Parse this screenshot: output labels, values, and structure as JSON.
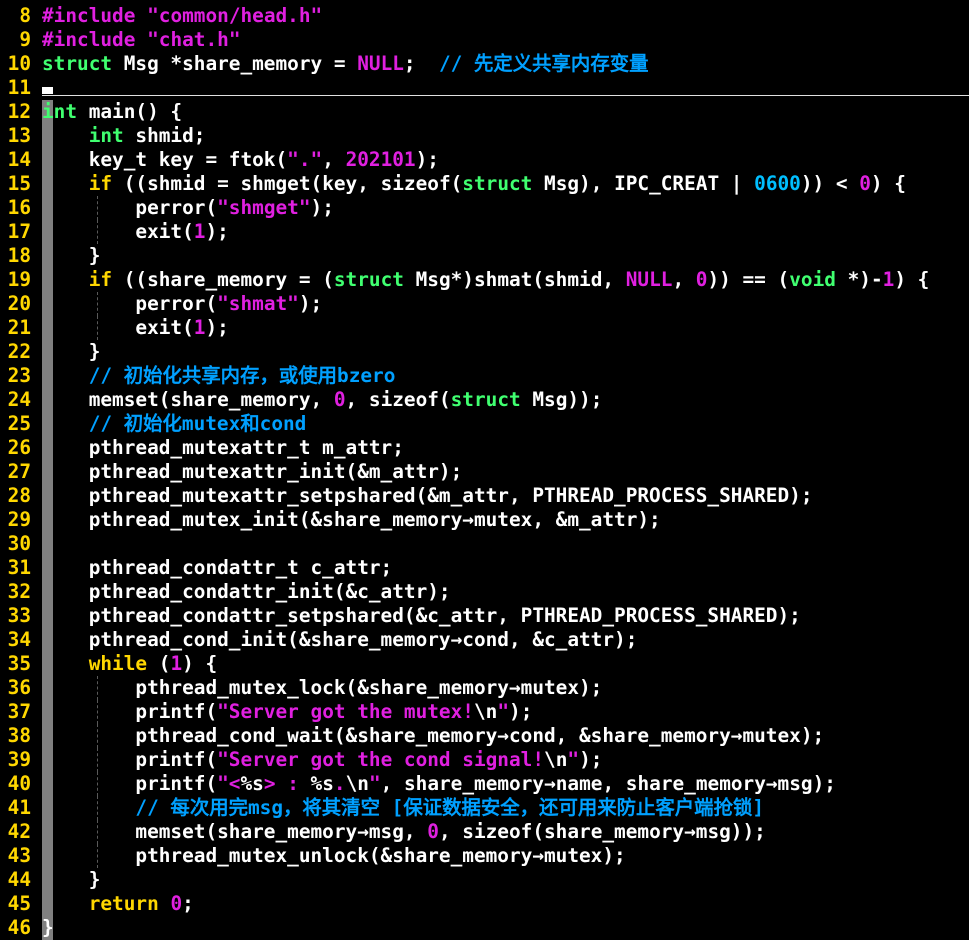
{
  "editor": {
    "colors": {
      "background": "#000000",
      "line_number": "#ffd700",
      "preprocessor": "#e020e0",
      "string": "#e020e0",
      "number": "#e020e0",
      "type": "#40ff70",
      "keyword": "#ffd700",
      "comment": "#00a0ff",
      "text": "#ffffff"
    },
    "lines": [
      {
        "n": "8",
        "tokens": [
          [
            "pp",
            "#include"
          ],
          [
            "txt",
            " "
          ],
          [
            "str",
            "\"common/head.h\""
          ]
        ]
      },
      {
        "n": "9",
        "tokens": [
          [
            "pp",
            "#include"
          ],
          [
            "txt",
            " "
          ],
          [
            "str",
            "\"chat.h\""
          ]
        ]
      },
      {
        "n": "10",
        "tokens": [
          [
            "type",
            "struct"
          ],
          [
            "txt",
            " Msg *share_memory = "
          ],
          [
            "num",
            "NULL"
          ],
          [
            "txt",
            ";  "
          ],
          [
            "cmt",
            "// 先定义共享内存变量"
          ]
        ]
      },
      {
        "n": "11",
        "tokens": []
      },
      {
        "n": "12",
        "tokens": [
          [
            "type",
            "int"
          ],
          [
            "txt",
            " main() {"
          ]
        ]
      },
      {
        "n": "13",
        "tokens": [
          [
            "txt",
            "    "
          ],
          [
            "type",
            "int"
          ],
          [
            "txt",
            " shmid;"
          ]
        ]
      },
      {
        "n": "14",
        "tokens": [
          [
            "txt",
            "    key_t key = ftok("
          ],
          [
            "str",
            "\".\""
          ],
          [
            "txt",
            ", "
          ],
          [
            "num",
            "202101"
          ],
          [
            "txt",
            ");"
          ]
        ]
      },
      {
        "n": "15",
        "tokens": [
          [
            "txt",
            "    "
          ],
          [
            "kw",
            "if"
          ],
          [
            "txt",
            " ((shmid = shmget(key, sizeof("
          ],
          [
            "type",
            "struct"
          ],
          [
            "txt",
            " Msg), IPC_CREAT | "
          ],
          [
            "hex",
            "0600"
          ],
          [
            "txt",
            ")) < "
          ],
          [
            "num",
            "0"
          ],
          [
            "txt",
            ") {"
          ]
        ]
      },
      {
        "n": "16",
        "tokens": [
          [
            "txt",
            "        perror("
          ],
          [
            "str",
            "\"shmget\""
          ],
          [
            "txt",
            ");"
          ]
        ]
      },
      {
        "n": "17",
        "tokens": [
          [
            "txt",
            "        exit("
          ],
          [
            "num",
            "1"
          ],
          [
            "txt",
            ");"
          ]
        ]
      },
      {
        "n": "18",
        "tokens": [
          [
            "txt",
            "    }"
          ]
        ]
      },
      {
        "n": "19",
        "tokens": [
          [
            "txt",
            "    "
          ],
          [
            "kw",
            "if"
          ],
          [
            "txt",
            " ((share_memory = ("
          ],
          [
            "type",
            "struct"
          ],
          [
            "txt",
            " Msg*)shmat(shmid, "
          ],
          [
            "num",
            "NULL"
          ],
          [
            "txt",
            ", "
          ],
          [
            "num",
            "0"
          ],
          [
            "txt",
            ")) == ("
          ],
          [
            "type",
            "void"
          ],
          [
            "txt",
            " *)-"
          ],
          [
            "num",
            "1"
          ],
          [
            "txt",
            ") {"
          ]
        ]
      },
      {
        "n": "20",
        "tokens": [
          [
            "txt",
            "        perror("
          ],
          [
            "str",
            "\"shmat\""
          ],
          [
            "txt",
            ");"
          ]
        ]
      },
      {
        "n": "21",
        "tokens": [
          [
            "txt",
            "        exit("
          ],
          [
            "num",
            "1"
          ],
          [
            "txt",
            ");"
          ]
        ]
      },
      {
        "n": "22",
        "tokens": [
          [
            "txt",
            "    }"
          ]
        ]
      },
      {
        "n": "23",
        "tokens": [
          [
            "txt",
            "    "
          ],
          [
            "cmt",
            "// 初始化共享内存，或使用bzero"
          ]
        ]
      },
      {
        "n": "24",
        "tokens": [
          [
            "txt",
            "    memset(share_memory, "
          ],
          [
            "num",
            "0"
          ],
          [
            "txt",
            ", sizeof("
          ],
          [
            "type",
            "struct"
          ],
          [
            "txt",
            " Msg));"
          ]
        ]
      },
      {
        "n": "25",
        "tokens": [
          [
            "txt",
            "    "
          ],
          [
            "cmt",
            "// 初始化mutex和cond"
          ]
        ]
      },
      {
        "n": "26",
        "tokens": [
          [
            "txt",
            "    pthread_mutexattr_t m_attr;"
          ]
        ]
      },
      {
        "n": "27",
        "tokens": [
          [
            "txt",
            "    pthread_mutexattr_init(&m_attr);"
          ]
        ]
      },
      {
        "n": "28",
        "tokens": [
          [
            "txt",
            "    pthread_mutexattr_setpshared(&m_attr, PTHREAD_PROCESS_SHARED);"
          ]
        ]
      },
      {
        "n": "29",
        "tokens": [
          [
            "txt",
            "    pthread_mutex_init(&share_memory→mutex, &m_attr);"
          ]
        ]
      },
      {
        "n": "30",
        "tokens": []
      },
      {
        "n": "31",
        "tokens": [
          [
            "txt",
            "    pthread_condattr_t c_attr;"
          ]
        ]
      },
      {
        "n": "32",
        "tokens": [
          [
            "txt",
            "    pthread_condattr_init(&c_attr);"
          ]
        ]
      },
      {
        "n": "33",
        "tokens": [
          [
            "txt",
            "    pthread_condattr_setpshared(&c_attr, PTHREAD_PROCESS_SHARED);"
          ]
        ]
      },
      {
        "n": "34",
        "tokens": [
          [
            "txt",
            "    pthread_cond_init(&share_memory→cond, &c_attr);"
          ]
        ]
      },
      {
        "n": "35",
        "tokens": [
          [
            "txt",
            "    "
          ],
          [
            "kw",
            "while"
          ],
          [
            "txt",
            " ("
          ],
          [
            "num",
            "1"
          ],
          [
            "txt",
            ") {"
          ]
        ]
      },
      {
        "n": "36",
        "tokens": [
          [
            "txt",
            "        pthread_mutex_lock(&share_memory→mutex);"
          ]
        ]
      },
      {
        "n": "37",
        "tokens": [
          [
            "txt",
            "        printf("
          ],
          [
            "str",
            "\"Server got the mutex!"
          ],
          [
            "esc",
            "\\n"
          ],
          [
            "str",
            "\""
          ],
          [
            "txt",
            ");"
          ]
        ]
      },
      {
        "n": "38",
        "tokens": [
          [
            "txt",
            "        pthread_cond_wait(&share_memory→cond, &share_memory→mutex);"
          ]
        ]
      },
      {
        "n": "39",
        "tokens": [
          [
            "txt",
            "        printf("
          ],
          [
            "str",
            "\"Server got the cond signal!"
          ],
          [
            "esc",
            "\\n"
          ],
          [
            "str",
            "\""
          ],
          [
            "txt",
            ");"
          ]
        ]
      },
      {
        "n": "40",
        "tokens": [
          [
            "txt",
            "        printf("
          ],
          [
            "str",
            "\"<"
          ],
          [
            "esc",
            "%s"
          ],
          [
            "str",
            "> : "
          ],
          [
            "esc",
            "%s"
          ],
          [
            "str",
            "."
          ],
          [
            "esc",
            "\\n"
          ],
          [
            "str",
            "\""
          ],
          [
            "txt",
            ", share_memory→name, share_memory→msg);"
          ]
        ]
      },
      {
        "n": "41",
        "tokens": [
          [
            "txt",
            "        "
          ],
          [
            "cmt",
            "// 每次用完msg，将其清空 [保证数据安全，还可用来防止客户端抢锁]"
          ]
        ]
      },
      {
        "n": "42",
        "tokens": [
          [
            "txt",
            "        memset(share_memory→msg, "
          ],
          [
            "num",
            "0"
          ],
          [
            "txt",
            ", sizeof(share_memory→msg));"
          ]
        ]
      },
      {
        "n": "43",
        "tokens": [
          [
            "txt",
            "        pthread_mutex_unlock(&share_memory→mutex);"
          ]
        ]
      },
      {
        "n": "44",
        "tokens": [
          [
            "txt",
            "    }"
          ]
        ]
      },
      {
        "n": "45",
        "tokens": [
          [
            "txt",
            "    "
          ],
          [
            "kw",
            "return"
          ],
          [
            "txt",
            " "
          ],
          [
            "num",
            "0"
          ],
          [
            "txt",
            ";"
          ]
        ]
      },
      {
        "n": "46",
        "tokens": [
          [
            "txt",
            "}"
          ]
        ]
      }
    ]
  }
}
